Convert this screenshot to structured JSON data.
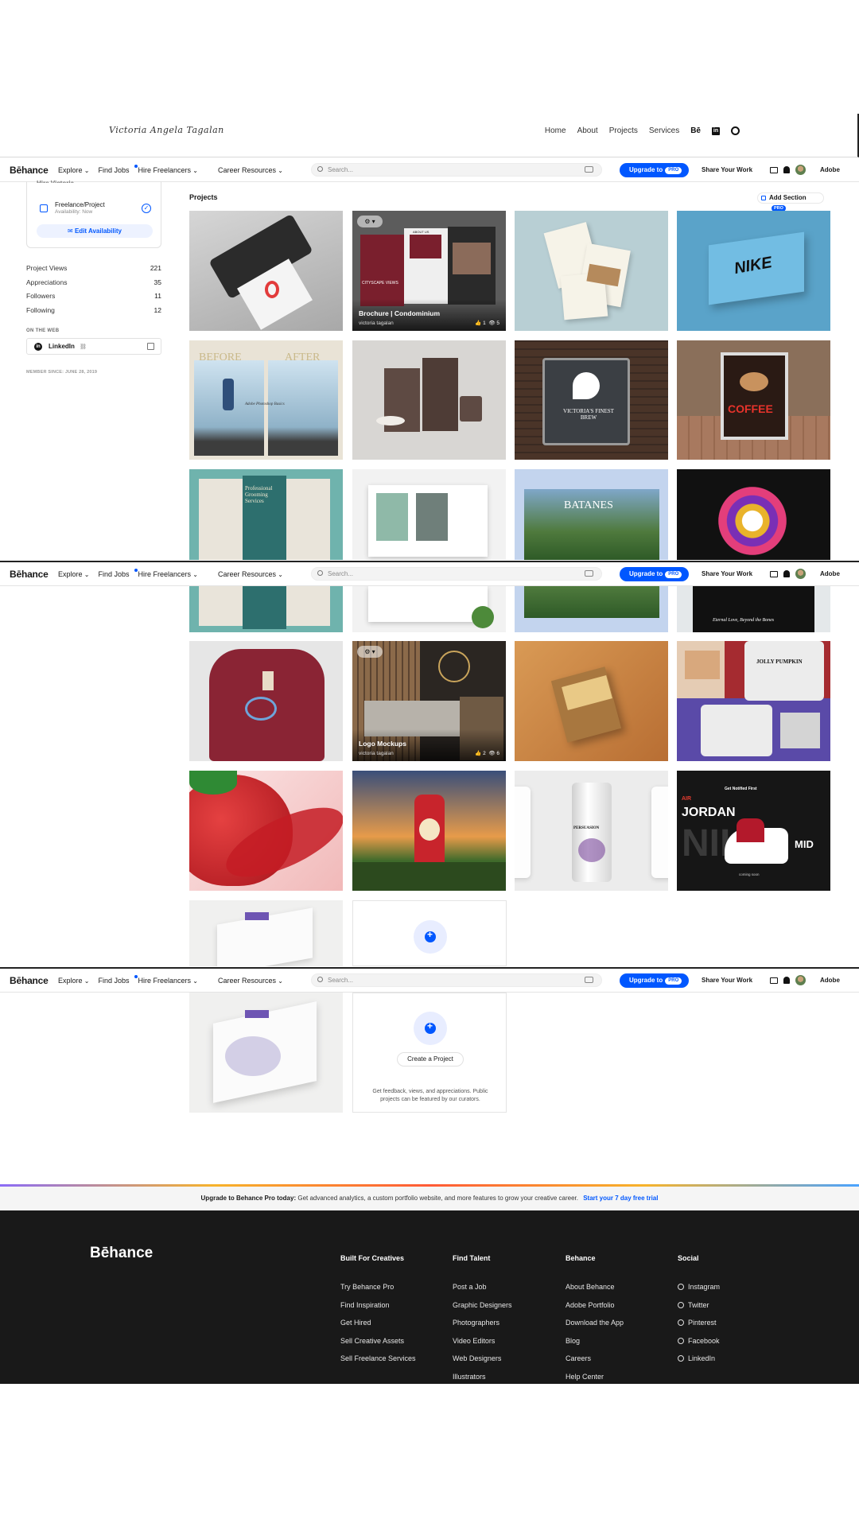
{
  "site": {
    "signature": "Victoria Angela Tagalan",
    "nav": [
      "Home",
      "About",
      "Projects",
      "Services"
    ],
    "nav_icons": [
      "behance-icon",
      "linkedin-icon",
      "github-icon"
    ],
    "be_label": "Bē",
    "in_label": "in"
  },
  "behance_bar": {
    "logo": "Bēhance",
    "menu": [
      "Explore",
      "Find Jobs",
      "Hire Freelancers",
      "Career Resources"
    ],
    "search_placeholder": "Search...",
    "upgrade_label": "Upgrade to",
    "pro_badge": "PRO",
    "share_label": "Share Your Work",
    "adobe_label": "Adobe"
  },
  "sidebar": {
    "cut_heading": "Hire Victoria",
    "availability_title": "Freelance/Project",
    "availability_sub": "Availability: Now",
    "edit_availability": "Edit Availability",
    "stats": [
      {
        "label": "Project Views",
        "value": "221"
      },
      {
        "label": "Appreciations",
        "value": "35"
      },
      {
        "label": "Followers",
        "value": "11"
      },
      {
        "label": "Following",
        "value": "12"
      }
    ],
    "on_the_web": "ON THE WEB",
    "linkedin": "LinkedIn",
    "member_since": "MEMBER SINCE: JUNE 28, 2019"
  },
  "projects": {
    "heading": "Projects",
    "add_section": "Add Section",
    "pro_badge": "PRO",
    "brochure": {
      "title": "Brochure | Condominium",
      "author": "victoria tagalan",
      "likes": "1",
      "views": "5",
      "img_text_1": "CITYSCAPE VIEWS",
      "img_text_2": "ABOUT US"
    },
    "logo_mockups": {
      "title": "Logo Mockups",
      "author": "victoria tagalan",
      "likes": "2",
      "views": "6"
    },
    "image_texts": {
      "nike": "NIKE",
      "before": "BEFORE",
      "after": "AFTER",
      "adobe_ps": "Adobe Photoshop Basics",
      "brew": "VICTORIA'S FINEST BREW",
      "coffee": "COFFEE",
      "grooming": "Professional Grooming Services",
      "batanes": "BATANES",
      "skull_caption": "Eternal Love, Beyond the Bones",
      "jordan": "JORDAN",
      "mid": "MID",
      "air": "AIR",
      "nike_big": "NIKE",
      "nike_top": "Get Notified First",
      "coming_soon": "coming soon",
      "jolly": "JOLLY PUMPKIN",
      "persuasion": "PERSUASION"
    },
    "create": {
      "button": "Create a Project",
      "desc": "Get feedback, views, and appreciations. Public projects can be featured by our curators."
    }
  },
  "upgrade_banner": {
    "bold": "Upgrade to Behance Pro today:",
    "text": "Get advanced analytics, a custom portfolio website, and more features to grow your creative career.",
    "link": "Start your 7 day free trial"
  },
  "footer": {
    "logo": "Bēhance",
    "columns": [
      {
        "heading": "Built For Creatives",
        "items": [
          "Try Behance Pro",
          "Find Inspiration",
          "Get Hired",
          "Sell Creative Assets",
          "Sell Freelance Services"
        ]
      },
      {
        "heading": "Find Talent",
        "items": [
          "Post a Job",
          "Graphic Designers",
          "Photographers",
          "Video Editors",
          "Web Designers",
          "Illustrators"
        ]
      },
      {
        "heading": "Behance",
        "items": [
          "About Behance",
          "Adobe Portfolio",
          "Download the App",
          "Blog",
          "Careers",
          "Help Center"
        ]
      },
      {
        "heading": "Social",
        "items": [
          "Instagram",
          "Twitter",
          "Pinterest",
          "Facebook",
          "LinkedIn"
        ]
      }
    ]
  }
}
